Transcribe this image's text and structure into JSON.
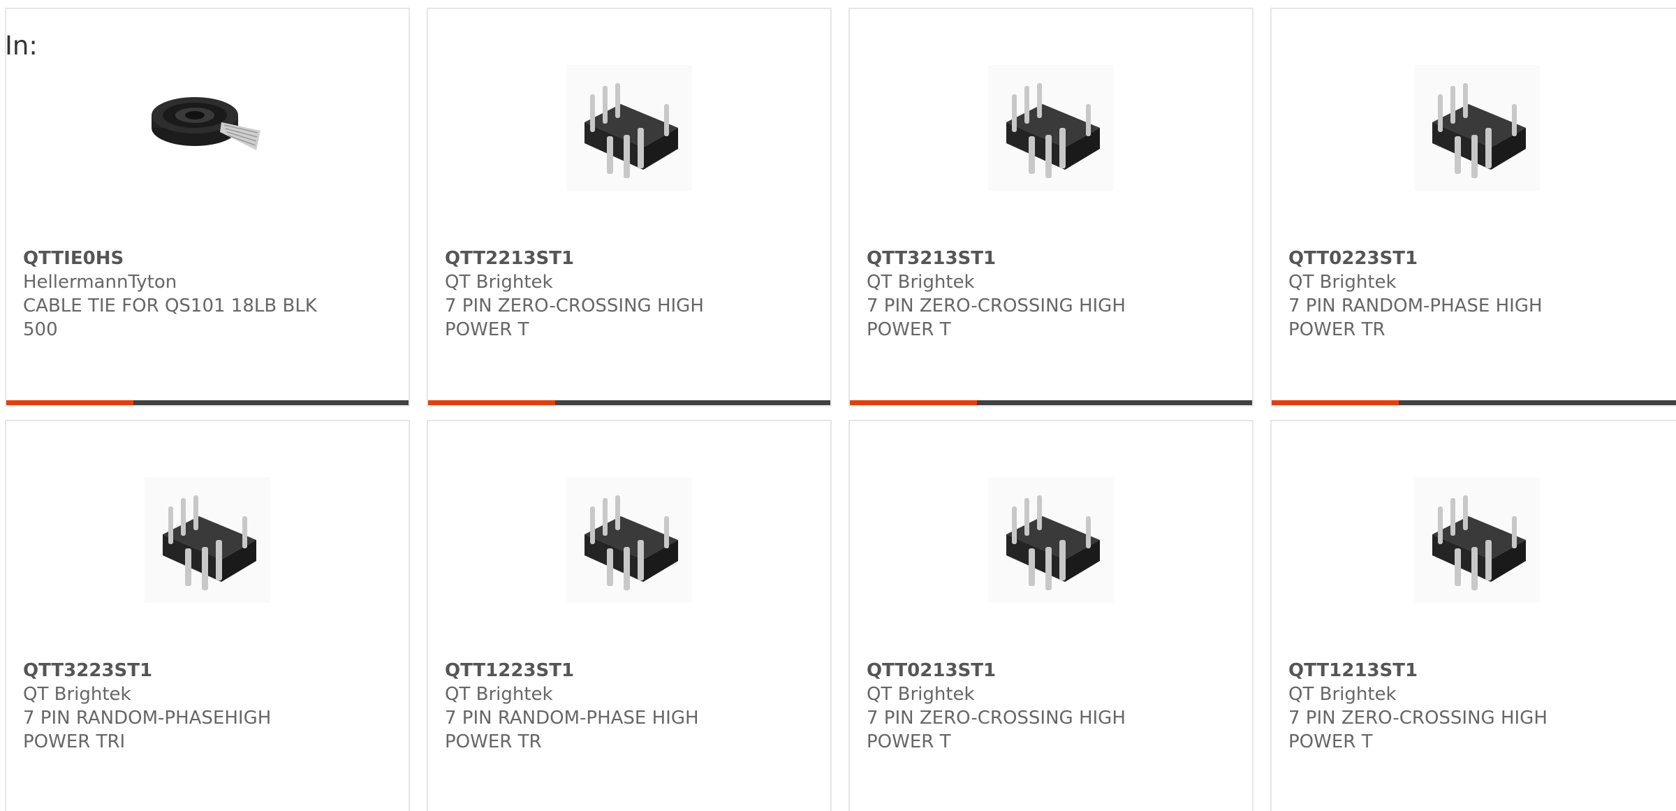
{
  "header": {
    "in_label": "In:"
  },
  "colors": {
    "accent": "#e0400d",
    "bar": "#414141",
    "border": "#e6e6e6",
    "text": "#666666"
  },
  "products": [
    {
      "part": "QTTIE0HS",
      "maker": "HellermannTyton",
      "desc": "CABLE TIE FOR QS101 18LB BLK 500",
      "image": "cable-tie-reel-icon"
    },
    {
      "part": "QTT2213ST1",
      "maker": "QT Brightek",
      "desc": "7 PIN ZERO-CROSSING HIGH POWER T",
      "image": "dip-chip-icon"
    },
    {
      "part": "QTT3213ST1",
      "maker": "QT Brightek",
      "desc": "7 PIN ZERO-CROSSING HIGH POWER T",
      "image": "dip-chip-icon"
    },
    {
      "part": "QTT0223ST1",
      "maker": "QT Brightek",
      "desc": "7 PIN RANDOM-PHASE HIGH POWER TR",
      "image": "dip-chip-icon"
    },
    {
      "part": "QTT3223ST1",
      "maker": "QT Brightek",
      "desc": "7 PIN RANDOM-PHASEHIGH POWER TRI",
      "image": "dip-chip-icon"
    },
    {
      "part": "QTT1223ST1",
      "maker": "QT Brightek",
      "desc": "7 PIN RANDOM-PHASE HIGH POWER TR",
      "image": "dip-chip-icon"
    },
    {
      "part": "QTT0213ST1",
      "maker": "QT Brightek",
      "desc": "7 PIN ZERO-CROSSING HIGH POWER T",
      "image": "dip-chip-icon"
    },
    {
      "part": "QTT1213ST1",
      "maker": "QT Brightek",
      "desc": "7 PIN ZERO-CROSSING HIGH POWER T",
      "image": "dip-chip-icon"
    }
  ]
}
